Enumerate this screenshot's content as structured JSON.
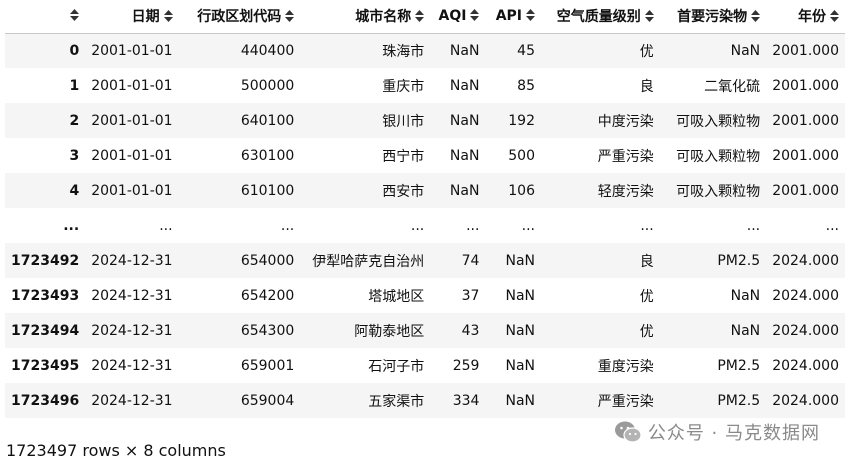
{
  "table": {
    "columns": [
      "",
      "日期",
      "行政区划代码",
      "城市名称",
      "AQI",
      "API",
      "空气质量级别",
      "首要污染物",
      "年份"
    ],
    "rows": [
      {
        "index": "0",
        "cells": [
          "2001-01-01",
          "440400",
          "珠海市",
          "NaN",
          "45",
          "优",
          "NaN",
          "2001.000"
        ]
      },
      {
        "index": "1",
        "cells": [
          "2001-01-01",
          "500000",
          "重庆市",
          "NaN",
          "85",
          "良",
          "二氧化硫",
          "2001.000"
        ]
      },
      {
        "index": "2",
        "cells": [
          "2001-01-01",
          "640100",
          "银川市",
          "NaN",
          "192",
          "中度污染",
          "可吸入颗粒物",
          "2001.000"
        ]
      },
      {
        "index": "3",
        "cells": [
          "2001-01-01",
          "630100",
          "西宁市",
          "NaN",
          "500",
          "严重污染",
          "可吸入颗粒物",
          "2001.000"
        ]
      },
      {
        "index": "4",
        "cells": [
          "2001-01-01",
          "610100",
          "西安市",
          "NaN",
          "106",
          "轻度污染",
          "可吸入颗粒物",
          "2001.000"
        ]
      },
      {
        "index": "...",
        "cells": [
          "...",
          "...",
          "...",
          "...",
          "...",
          "...",
          "...",
          "..."
        ]
      },
      {
        "index": "1723492",
        "cells": [
          "2024-12-31",
          "654000",
          "伊犁哈萨克自治州",
          "74",
          "NaN",
          "良",
          "PM2.5",
          "2024.000"
        ]
      },
      {
        "index": "1723493",
        "cells": [
          "2024-12-31",
          "654200",
          "塔城地区",
          "37",
          "NaN",
          "优",
          "NaN",
          "2024.000"
        ]
      },
      {
        "index": "1723494",
        "cells": [
          "2024-12-31",
          "654300",
          "阿勒泰地区",
          "43",
          "NaN",
          "优",
          "NaN",
          "2024.000"
        ]
      },
      {
        "index": "1723495",
        "cells": [
          "2024-12-31",
          "659001",
          "石河子市",
          "259",
          "NaN",
          "重度污染",
          "PM2.5",
          "2024.000"
        ]
      },
      {
        "index": "1723496",
        "cells": [
          "2024-12-31",
          "659004",
          "五家渠市",
          "334",
          "NaN",
          "严重污染",
          "PM2.5",
          "2024.000"
        ]
      }
    ]
  },
  "footer": {
    "shape_text": "1723497 rows × 8 columns"
  },
  "watermark": {
    "text": "公众号 · 马克数据网",
    "icon": "wechat-icon"
  }
}
